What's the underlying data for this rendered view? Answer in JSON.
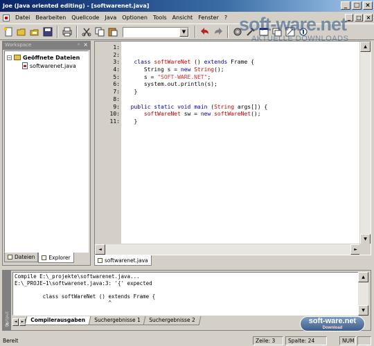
{
  "window": {
    "title": "Joe (Java oriented editing) - [softwarenet.java]",
    "controls": [
      "_",
      "□",
      "×"
    ]
  },
  "menu": {
    "items": [
      "Datei",
      "Bearbeiten",
      "Quellcode",
      "Java",
      "Optionen",
      "Tools",
      "Ansicht",
      "Fenster",
      "?"
    ],
    "mdi_controls": [
      "_",
      "□",
      "×"
    ]
  },
  "toolbar": {
    "icons": [
      "new-file-icon",
      "open-folder-icon",
      "open-icon",
      "save-icon",
      "print-icon",
      "cut-icon",
      "copy-icon",
      "paste-icon",
      "undo-icon",
      "redo-icon",
      "gear-icon",
      "build-icon",
      "run-icon",
      "window-icon",
      "window-icon",
      "help-icon"
    ],
    "combo_value": ""
  },
  "watermark": {
    "main": "soft-ware.net",
    "sub": "AKTUELLE DOWNLOADS"
  },
  "workspace": {
    "title": "Workspace",
    "root_label": "Geöffnete Dateien",
    "file_label": "softwarenet.java",
    "tabs": [
      "Dateien",
      "Explorer"
    ]
  },
  "editor": {
    "lines": [
      {
        "num": "1:",
        "code": ""
      },
      {
        "num": "2:",
        "code": ""
      },
      {
        "num": "3:",
        "code": "   class softWareNet () extends Frame {"
      },
      {
        "num": "4:",
        "code": "      String s = new String();"
      },
      {
        "num": "5:",
        "code": "      s = \"SOFT-WARE.NET\";"
      },
      {
        "num": "6:",
        "code": "      system.out.println(s);"
      },
      {
        "num": "7:",
        "code": "   }"
      },
      {
        "num": "8:",
        "code": ""
      },
      {
        "num": "9:",
        "code": "  public static void main (String args[]) {"
      },
      {
        "num": "10:",
        "code": "      softWareNet sw = new softWareNet();"
      },
      {
        "num": "11:",
        "code": "   }"
      }
    ],
    "tab_label": "softwarenet.java"
  },
  "output": {
    "side_label": "Output",
    "lines": [
      "Compile E:\\_projekte\\softwarenet.java...",
      "E:\\_PROJE~1\\softwarenet.java:3: '{' expected",
      "",
      "         class softWareNet () extends Frame {",
      "                              ^"
    ],
    "tabs": [
      "Compilerausgaben",
      "Suchergebnisse 1",
      "Suchergebnisse 2"
    ]
  },
  "badge": {
    "main": "soft-ware.net",
    "sub": "Download"
  },
  "status": {
    "text": "Bereit",
    "line": "Zeile: 3",
    "col": "Spalte: 24",
    "num": "NUM"
  }
}
